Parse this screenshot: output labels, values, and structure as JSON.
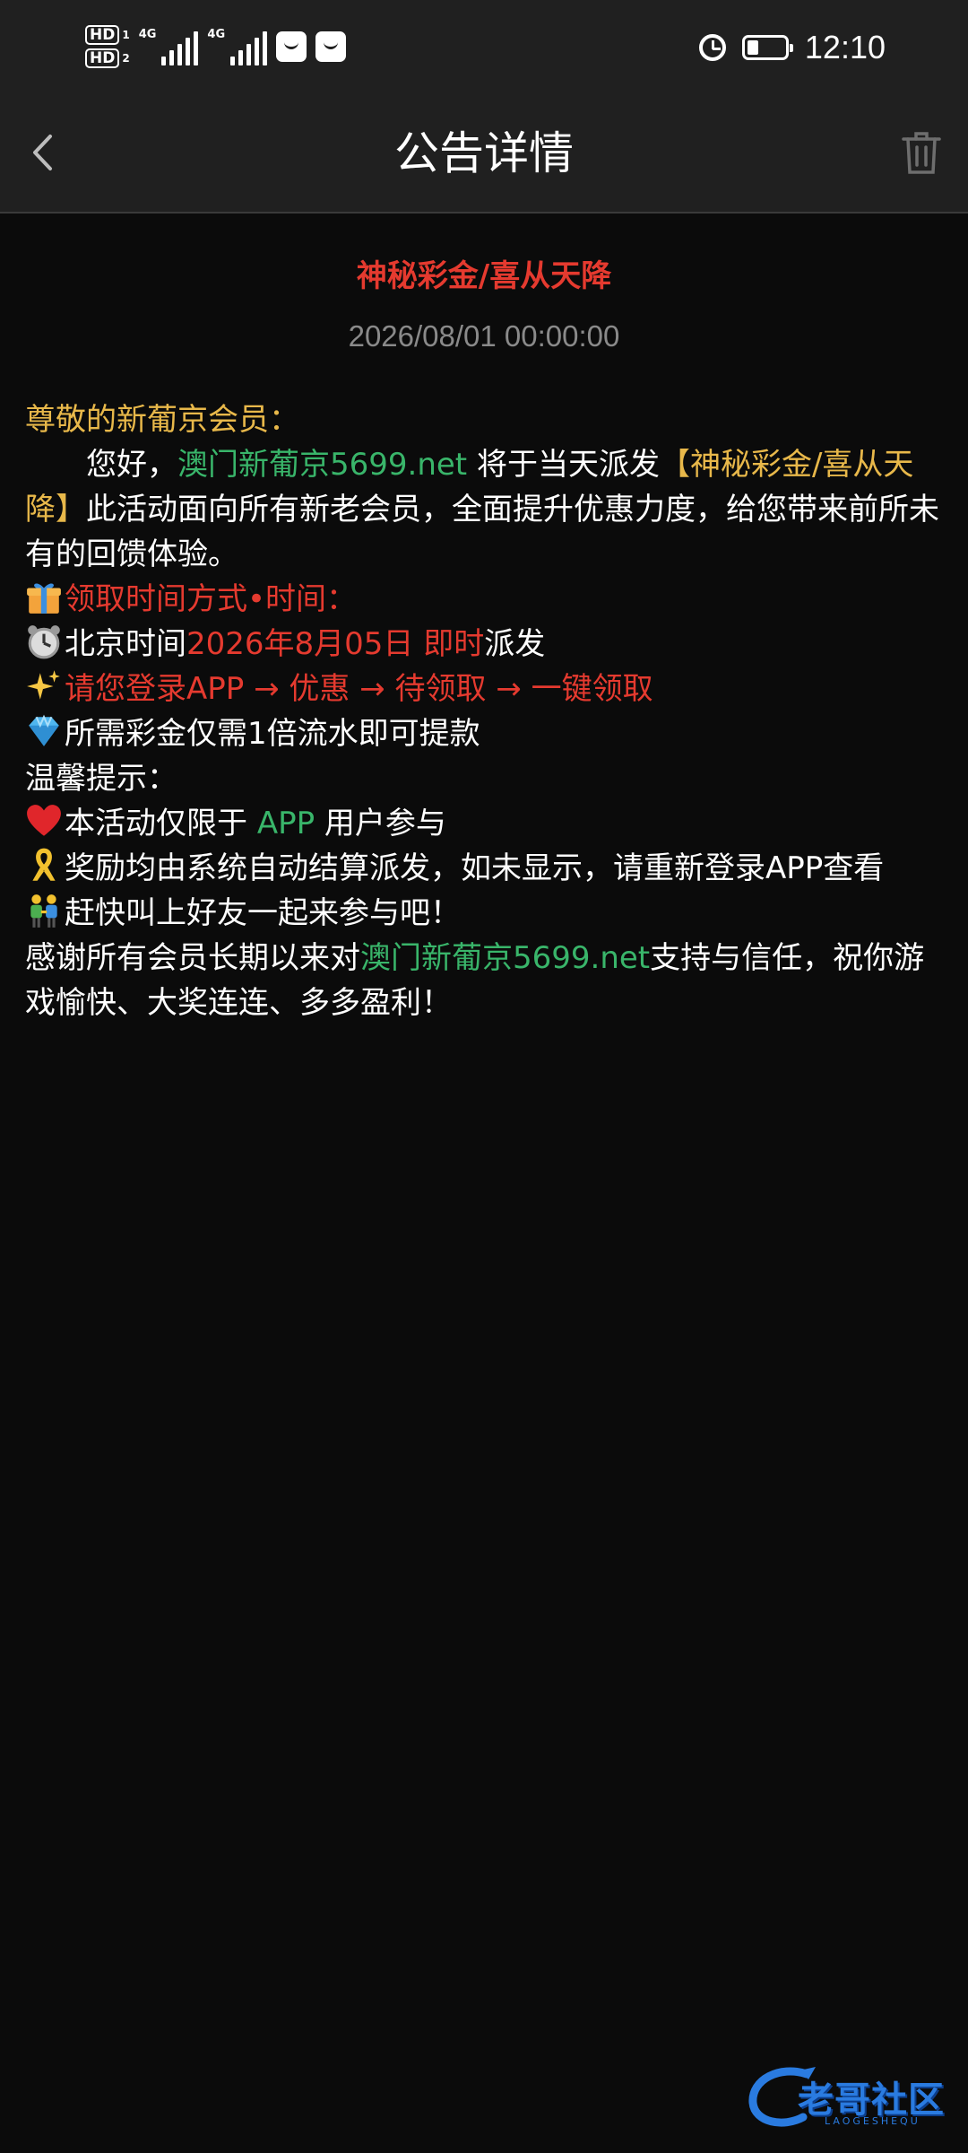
{
  "status_bar": {
    "time": "12:10",
    "hd1": "HD",
    "hd1_sub": "1",
    "hd2": "HD",
    "hd2_sub": "2",
    "net1": "4G",
    "net2": "4G",
    "battery_level": 0.3
  },
  "navbar": {
    "title": "公告详情",
    "back_icon": "chevron-left-icon",
    "delete_icon": "trash-icon"
  },
  "notice": {
    "title": "神秘彩金/喜从天降",
    "date": "2026/08/01 00:00:00",
    "greeting": "尊敬的新葡京会员：",
    "intro_1": "您好，",
    "intro_site": "澳门新葡京5699.net",
    "intro_2": " 将于当天派发",
    "intro_event": "【神秘彩金/喜从天降】",
    "intro_3": "此活动面向所有新老会员，全面提升优惠力度，给您带来前所未有的回馈体验。",
    "line_claim_label": "领取时间方式•时间：",
    "line_time_1": "北京时间",
    "line_time_red": "2026年8月05日 即时",
    "line_time_2": "派发",
    "line_steps": "请您登录APP → 优惠 → 待领取 → 一键领取",
    "line_turnover": "所需彩金仅需1倍流水即可提款",
    "tips_label": "温馨提示：",
    "line_app_1": "本活动仅限于 ",
    "line_app_green": "APP",
    "line_app_2": " 用户参与",
    "line_auto": "奖励均由系统自动结算派发，如未显示，请重新登录APP查看",
    "line_friends": "赶快叫上好友一起来参与吧！",
    "thanks_1": "感谢所有会员长期以来对",
    "thanks_site": "澳门新葡京5699.net",
    "thanks_2": "支持与信任，祝你游戏愉快、大奖连连、多多盈利！"
  },
  "watermark": {
    "text": "老哥社区",
    "sub": "LAOGESHEQU"
  },
  "colors": {
    "title_red": "#e53a2f",
    "accent_yellow": "#e8b84a",
    "accent_green": "#39b56a",
    "background": "#0b0b0b",
    "bar": "#202020"
  }
}
